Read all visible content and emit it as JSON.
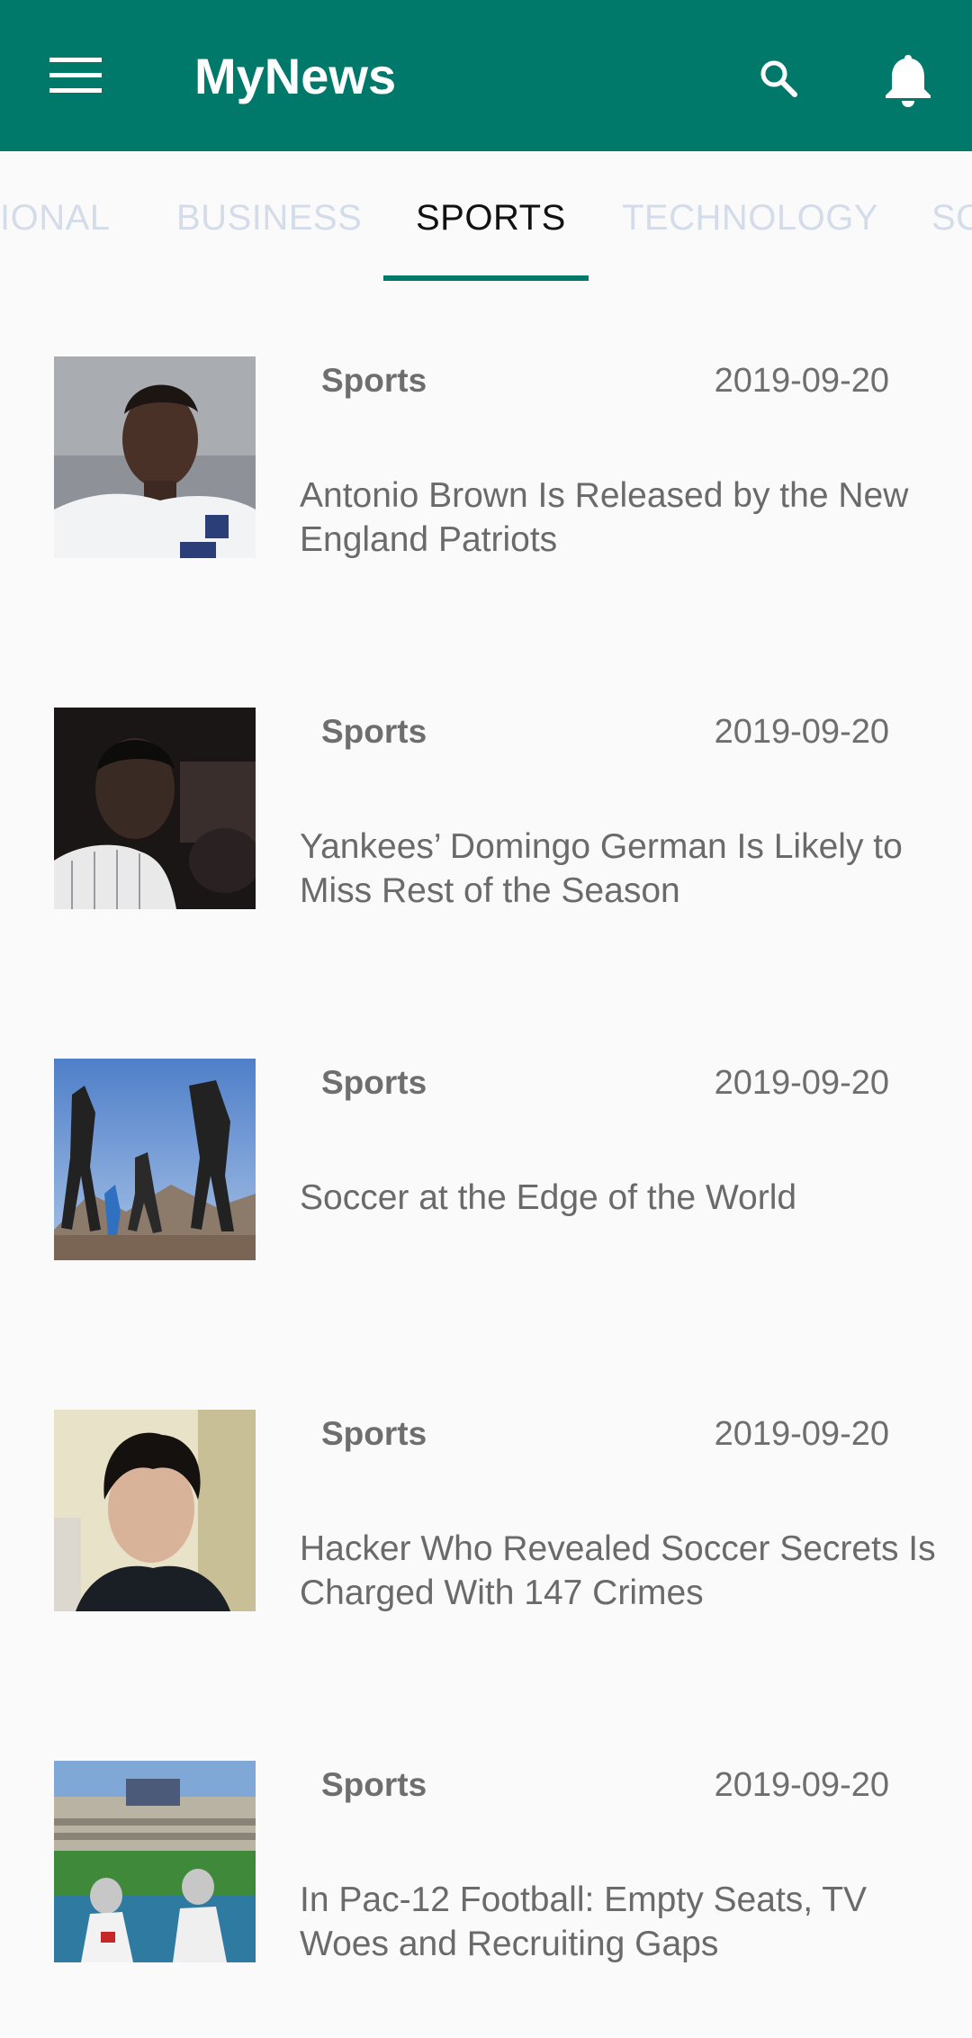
{
  "app": {
    "title": "MyNews"
  },
  "tabs": [
    {
      "label": "IONAL",
      "active": false
    },
    {
      "label": "BUSINESS",
      "active": false
    },
    {
      "label": "SPORTS",
      "active": true
    },
    {
      "label": "TECHNOLOGY",
      "active": false
    },
    {
      "label": "SC",
      "active": false
    }
  ],
  "colors": {
    "primary": "#00796b",
    "tab_inactive": "#d4dbe9",
    "text_secondary": "#6e6e6e"
  },
  "articles": [
    {
      "category": "Sports",
      "date": "2019-09-20",
      "headline": "Antonio Brown Is Released by the New England Patriots",
      "thumbnail": "football-player-photo"
    },
    {
      "category": "Sports",
      "date": "2019-09-20",
      "headline": "Yankees’ Domingo German Is Likely to Miss Rest of the Season",
      "thumbnail": "baseball-player-photo"
    },
    {
      "category": "Sports",
      "date": "2019-09-20",
      "headline": "Soccer at the Edge of the World",
      "thumbnail": "soccer-players-stretching-photo"
    },
    {
      "category": "Sports",
      "date": "2019-09-20",
      "headline": "Hacker Who Revealed Soccer Secrets Is Charged With 147 Crimes",
      "thumbnail": "man-portrait-photo"
    },
    {
      "category": "Sports",
      "date": "2019-09-20",
      "headline": "In Pac-12 Football: Empty Seats, TV Woes and Recruiting Gaps",
      "thumbnail": "stadium-football-photo"
    }
  ]
}
